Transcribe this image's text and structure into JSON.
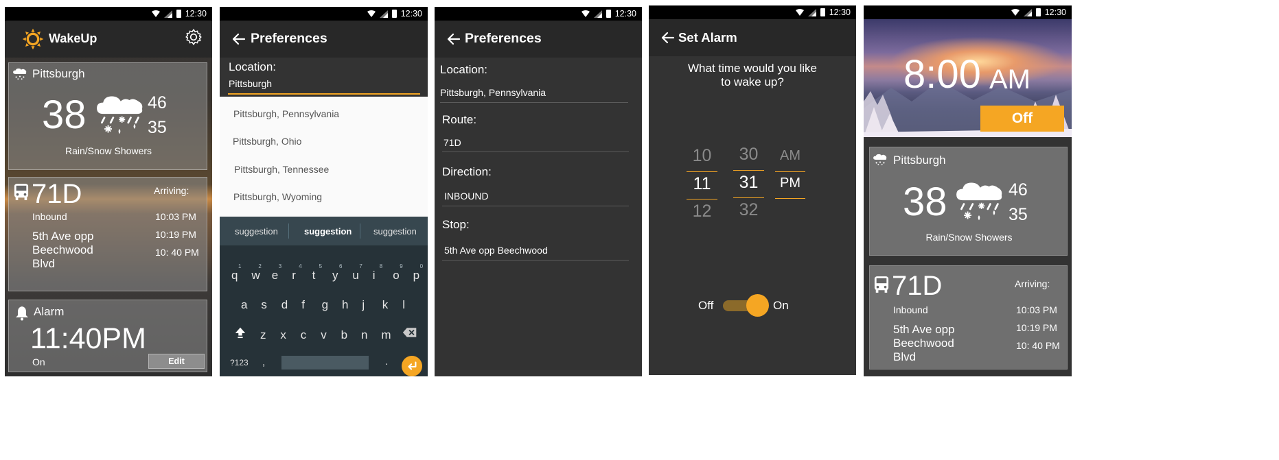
{
  "status": {
    "time": "12:30"
  },
  "screen1": {
    "app_title": "WakeUp",
    "weather": {
      "city": "Pittsburgh",
      "temp": "38",
      "high": "46",
      "low": "35",
      "condition": "Rain/Snow Showers"
    },
    "bus": {
      "route": "71D",
      "direction": "Inbound",
      "stop": [
        "5th Ave opp",
        "Beechwood",
        "Blvd"
      ],
      "arriving_label": "Arriving:",
      "times": [
        "10:03 PM",
        "10:19 PM",
        "10: 40 PM"
      ]
    },
    "alarm": {
      "label": "Alarm",
      "time": "11:40PM",
      "state": "On",
      "edit_label": "Edit"
    }
  },
  "screen2": {
    "title": "Preferences",
    "location_label": "Location:",
    "location_value": "Pittsburgh",
    "suggestions": [
      "Pittsburgh, Pennsylvania",
      "Pittsburgh, Ohio",
      "Pittsburgh, Tennessee",
      "Pittsburgh, Wyoming"
    ],
    "keyboard": {
      "strip": [
        "suggestion",
        "suggestion",
        "suggestion"
      ],
      "row1": [
        "q",
        "w",
        "e",
        "r",
        "t",
        "y",
        "u",
        "i",
        "o",
        "p"
      ],
      "row1_hints": [
        "1",
        "2",
        "3",
        "4",
        "5",
        "6",
        "7",
        "8",
        "9",
        "0"
      ],
      "row2": [
        "a",
        "s",
        "d",
        "f",
        "g",
        "h",
        "j",
        "k",
        "l"
      ],
      "row3": [
        "z",
        "x",
        "c",
        "v",
        "b",
        "n",
        "m"
      ],
      "symbols": "?123",
      "comma": ",",
      "period": "."
    }
  },
  "screen3": {
    "title": "Preferences",
    "location_label": "Location:",
    "location_value": "Pittsburgh, Pennsylvania",
    "route_label": "Route:",
    "route_value": "71D",
    "direction_label": "Direction:",
    "direction_value": "INBOUND",
    "stop_label": "Stop:",
    "stop_value": "5th Ave opp Beechwood"
  },
  "screen4": {
    "title": "Set Alarm",
    "prompt_line1": "What time would you like",
    "prompt_line2": "to wake up?",
    "hours": [
      "10",
      "11",
      "12"
    ],
    "minutes": [
      "30",
      "31",
      "32"
    ],
    "ampm": [
      "AM",
      "PM"
    ],
    "off_label": "Off",
    "on_label": "On",
    "toggle_on": true
  },
  "screen5": {
    "alarm_time": "8:00",
    "alarm_ampm": "AM",
    "off_button": "Off",
    "weather": {
      "city": "Pittsburgh",
      "temp": "38",
      "high": "46",
      "low": "35",
      "condition": "Rain/Snow Showers"
    },
    "bus": {
      "route": "71D",
      "direction": "Inbound",
      "stop": [
        "5th Ave opp",
        "Beechwood",
        "Blvd"
      ],
      "arriving_label": "Arriving:",
      "times": [
        "10:03 PM",
        "10:19 PM",
        "10: 40 PM"
      ]
    }
  },
  "colors": {
    "accent": "#f5a623",
    "dark": "#333333",
    "appbar": "#282828"
  }
}
